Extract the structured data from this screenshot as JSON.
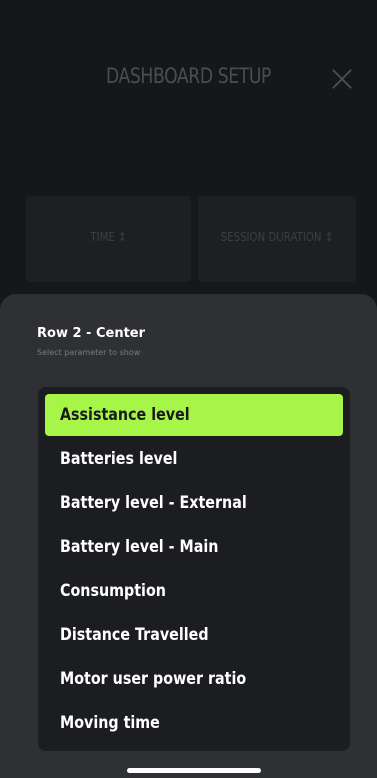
{
  "dashboard": {
    "title": "DASHBOARD SETUP",
    "tiles": [
      {
        "label": "TIME ↕"
      },
      {
        "label": "SESSION DURATION ↕"
      }
    ]
  },
  "sheet": {
    "title": "Row 2 - Center",
    "subtitle": "Select parameter to show",
    "selected_index": 0,
    "options": [
      {
        "label": "Assistance level"
      },
      {
        "label": "Batteries level"
      },
      {
        "label": "Battery level - External"
      },
      {
        "label": "Battery level - Main"
      },
      {
        "label": "Consumption"
      },
      {
        "label": "Distance Travelled"
      },
      {
        "label": "Motor user power ratio"
      },
      {
        "label": "Moving time"
      }
    ]
  },
  "colors": {
    "accent": "#a6f548",
    "background": "#161719",
    "sheet": "#2f3034",
    "list": "#1c1d20"
  }
}
